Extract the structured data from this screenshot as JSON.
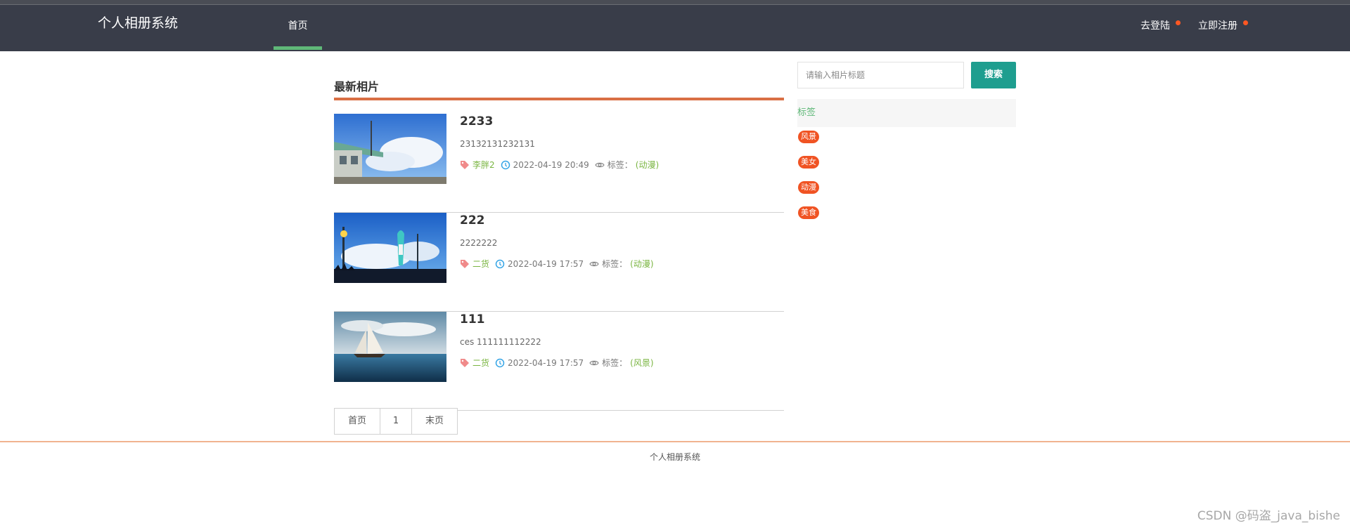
{
  "header": {
    "brand": "个人相册系统",
    "nav_home": "首页",
    "login": "去登陆",
    "register": "立即注册"
  },
  "main": {
    "section_title": "最新相片",
    "posts": [
      {
        "title": "2233",
        "desc": "23132131232131",
        "author": "李胖2",
        "time": "2022-04-19 20:49",
        "tag_label": "标签：",
        "tag": "(动漫)"
      },
      {
        "title": "222",
        "desc": "2222222",
        "author": "二货",
        "time": "2022-04-19 17:57",
        "tag_label": "标签：",
        "tag": "(动漫)"
      },
      {
        "title": "111",
        "desc": "ces 111111112222",
        "author": "二货",
        "time": "2022-04-19 17:57",
        "tag_label": "标签：",
        "tag": "(风景)"
      }
    ],
    "pager": {
      "first": "首页",
      "page": "1",
      "last": "末页"
    }
  },
  "sidebar": {
    "search_placeholder": "请输入相片标题",
    "search_button": "搜索",
    "tags_header": "标签",
    "tags": [
      "风景",
      "美女",
      "动漫",
      "美食"
    ]
  },
  "footer": {
    "text": "个人相册系统"
  },
  "watermark": "CSDN @码盗_java_bishe",
  "colors": {
    "header_bg": "#393d49",
    "accent_green": "#5fb878",
    "search_button": "#1e9e8f",
    "tag_pill": "#f05323",
    "section_bar": "#d96f44"
  }
}
